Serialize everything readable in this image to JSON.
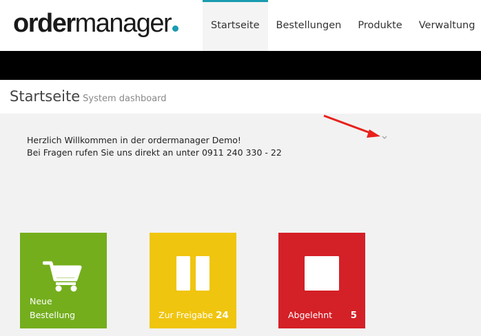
{
  "brand": {
    "logo_bold": "order",
    "logo_light": "manager",
    "accent_color": "#1a9bb0"
  },
  "nav": {
    "tabs": [
      {
        "label": "Startseite",
        "active": true
      },
      {
        "label": "Bestellungen",
        "active": false
      },
      {
        "label": "Produkte",
        "active": false
      },
      {
        "label": "Verwaltung",
        "active": false
      }
    ]
  },
  "page": {
    "title": "Startseite",
    "subtitle": "System dashboard"
  },
  "welcome": {
    "line1": "Herzlich Willkommen in der ordermanager Demo!",
    "line2": "Bei Fragen rufen Sie uns direkt an unter 0911 240 330 - 22",
    "toggle_icon": "chevron-down-icon"
  },
  "tiles": [
    {
      "label_line1": "Neue",
      "label_line2": "Bestellung",
      "count": "",
      "icon": "cart-icon",
      "color": "#74ae1d"
    },
    {
      "label_line1": "Zur Freigabe",
      "label_line2": "",
      "count": "24",
      "icon": "pause-icon",
      "color": "#f0c50f"
    },
    {
      "label_line1": "Abgelehnt",
      "label_line2": "",
      "count": "5",
      "icon": "stop-icon",
      "color": "#d42027"
    }
  ],
  "annotation": {
    "arrow_color": "#e8211b"
  }
}
